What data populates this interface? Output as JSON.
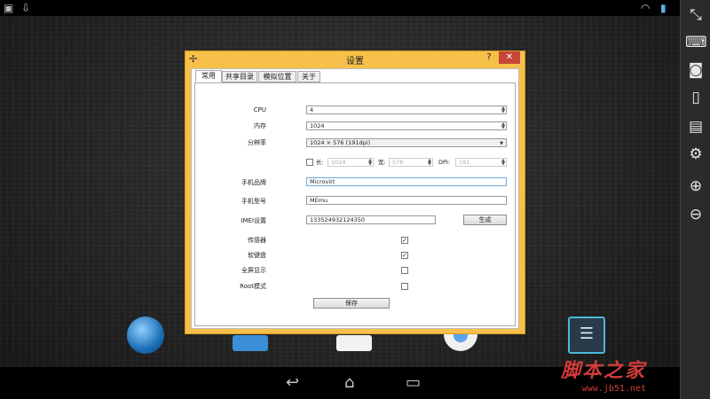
{
  "emulator": {
    "statusbar": {
      "left_icons": [
        "image-icon",
        "download-icon"
      ],
      "right_icons": [
        "wifi-icon",
        "battery-icon"
      ]
    },
    "toolbar": {
      "buttons": [
        "fullscreen-icon",
        "keyboard-icon",
        "camera-icon",
        "rotate-icon",
        "apk-icon",
        "settings-icon",
        "volume-up-icon",
        "volume-down-icon"
      ]
    },
    "navbar": {
      "buttons": [
        "back-icon",
        "home-icon",
        "recent-apps-icon"
      ]
    },
    "watermark": "脚本之家",
    "watermark_url": "www.jb51.net"
  },
  "dialog": {
    "title": "设置",
    "help": "?",
    "close": "✕",
    "tabs": [
      {
        "label": "常用",
        "active": true
      },
      {
        "label": "共享目录",
        "active": false
      },
      {
        "label": "模拟位置",
        "active": false
      },
      {
        "label": "关于",
        "active": false
      }
    ],
    "fields": {
      "cpu": {
        "label": "CPU",
        "value": "4"
      },
      "memory": {
        "label": "内存",
        "value": "1024"
      },
      "resolution": {
        "label": "分辨率",
        "value": "1024 × 576 (191dpi)"
      },
      "custom": {
        "length_label": "长:",
        "length": "1024",
        "width_label": "宽:",
        "width": "576",
        "dpi_label": "DPI:",
        "dpi": "191"
      },
      "brand": {
        "label": "手机品牌",
        "value": "Microvirt"
      },
      "model": {
        "label": "手机型号",
        "value": "MEmu"
      },
      "imei": {
        "label": "IMEI设置",
        "value": "133524932124350",
        "button": "生成"
      }
    },
    "checks": [
      {
        "label": "传感器",
        "checked": true
      },
      {
        "label": "软键盘",
        "checked": true
      },
      {
        "label": "全屏显示",
        "checked": false
      },
      {
        "label": "Root模式",
        "checked": false
      }
    ],
    "save": "保存"
  }
}
